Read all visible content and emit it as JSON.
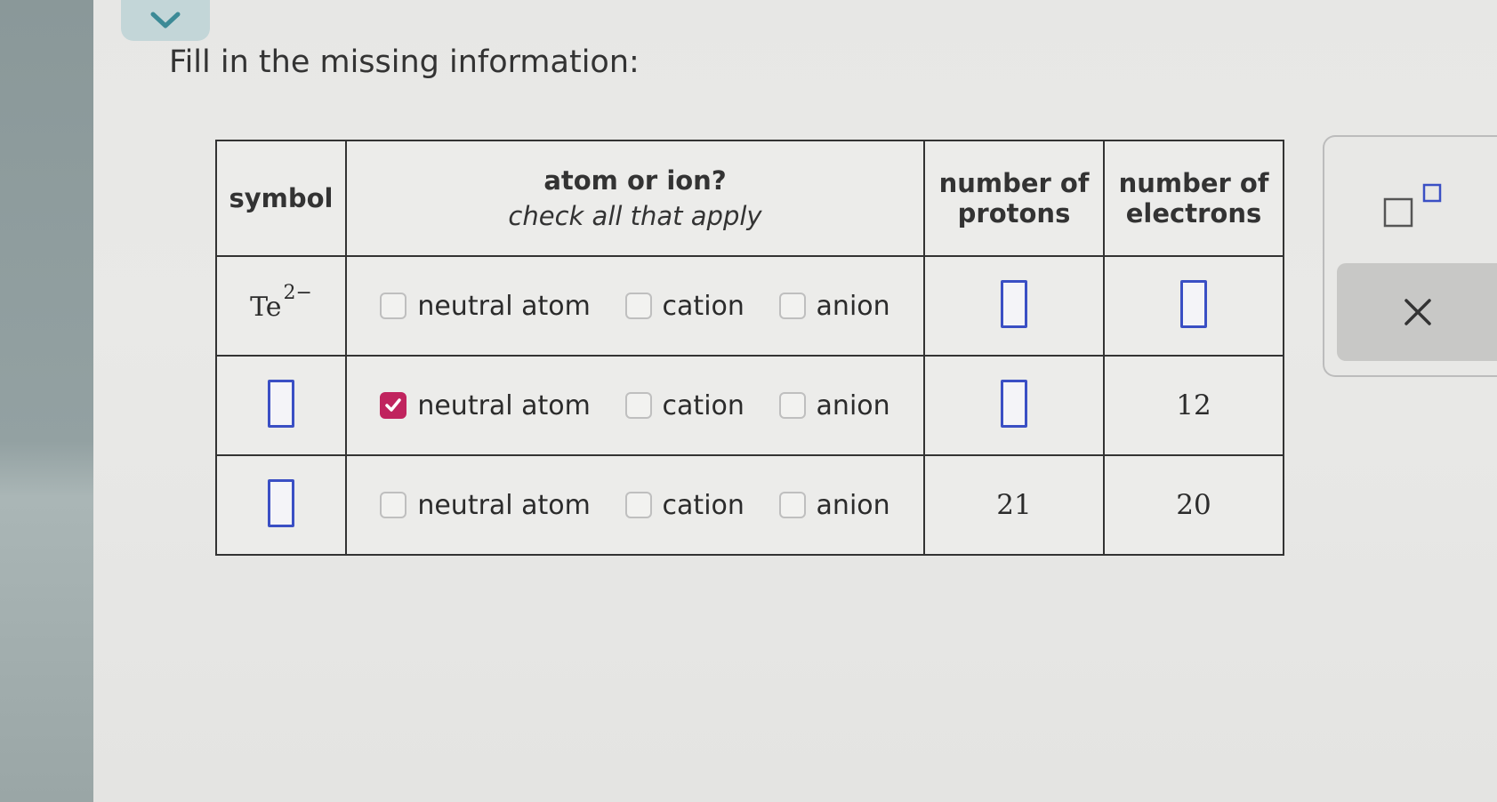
{
  "prompt": "Fill in the missing information:",
  "table": {
    "headers": {
      "symbol": "symbol",
      "atom_or_ion": "atom or ion?",
      "atom_or_ion_sub": "check all that apply",
      "protons": "number of protons",
      "electrons": "number of electrons"
    },
    "option_labels": [
      "neutral atom",
      "cation",
      "anion"
    ],
    "rows": [
      {
        "symbol_base": "Te",
        "symbol_charge": "2−",
        "checked": [
          false,
          false,
          false
        ],
        "protons": "",
        "electrons": ""
      },
      {
        "symbol_base": "",
        "symbol_charge": "",
        "checked": [
          true,
          false,
          false
        ],
        "protons": "",
        "electrons": "12"
      },
      {
        "symbol_base": "",
        "symbol_charge": "",
        "checked": [
          false,
          false,
          false
        ],
        "protons": "21",
        "electrons": "20"
      }
    ]
  },
  "icons": {
    "collapse": "chevron-down-icon",
    "superscript": "superscript-icon",
    "clear": "close-icon",
    "checkmark": "checkmark-icon"
  },
  "colors": {
    "accent_checked": "#c0245e",
    "answer_box": "#3a4fc4"
  }
}
